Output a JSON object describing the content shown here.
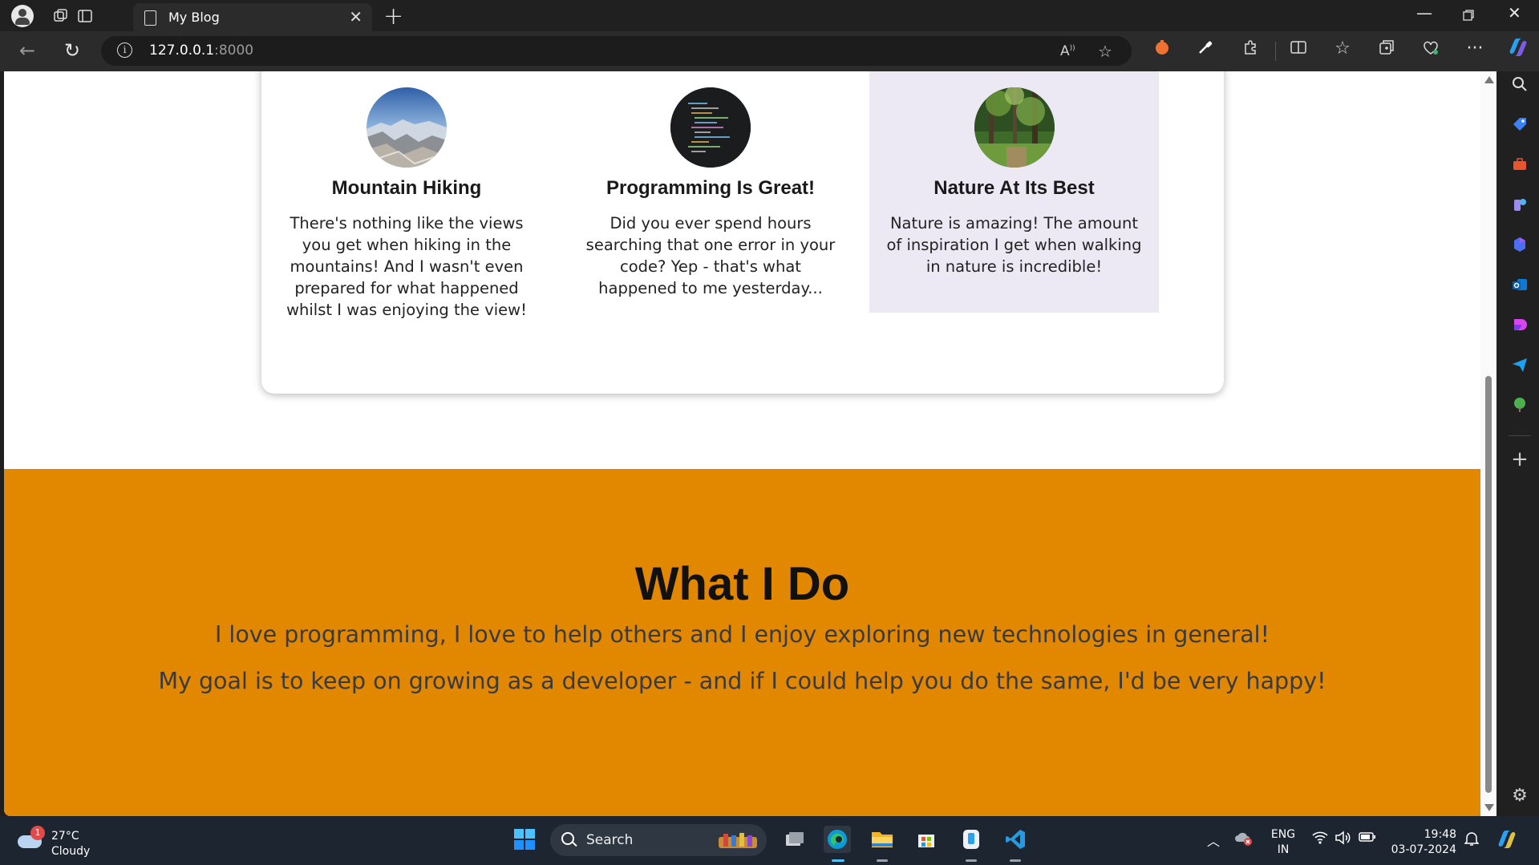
{
  "browser": {
    "tab_title": "My Blog",
    "url_host": "127.0.0.1",
    "url_port": ":8000"
  },
  "posts": [
    {
      "title": "Mountain Hiking",
      "excerpt": "There's nothing like the views you get when hiking in the mountains! And I wasn't even prepared for what happened whilst I was enjoying the view!",
      "image": "mountain-photo"
    },
    {
      "title": "Programming Is Great!",
      "excerpt": "Did you ever spend hours searching that one error in your code? Yep - that's what happened to me yesterday...",
      "image": "code-photo"
    },
    {
      "title": "Nature At Its Best",
      "excerpt": "Nature is amazing! The amount of inspiration I get when walking in nature is incredible!",
      "image": "forest-photo",
      "highlighted": true
    }
  ],
  "what_i_do": {
    "heading": "What I Do",
    "line1": "I love programming, I love to help others and I enjoy exploring new technologies in general!",
    "line2": "My goal is to keep on growing as a developer - and if I could help you do the same, I'd be very happy!",
    "background": "#e28700"
  },
  "taskbar": {
    "weather_temp": "27°C",
    "weather_desc": "Cloudy",
    "weather_badge": "1",
    "search_placeholder": "Search",
    "lang_1": "ENG",
    "lang_2": "IN",
    "time": "19:48",
    "date": "03-07-2024"
  }
}
